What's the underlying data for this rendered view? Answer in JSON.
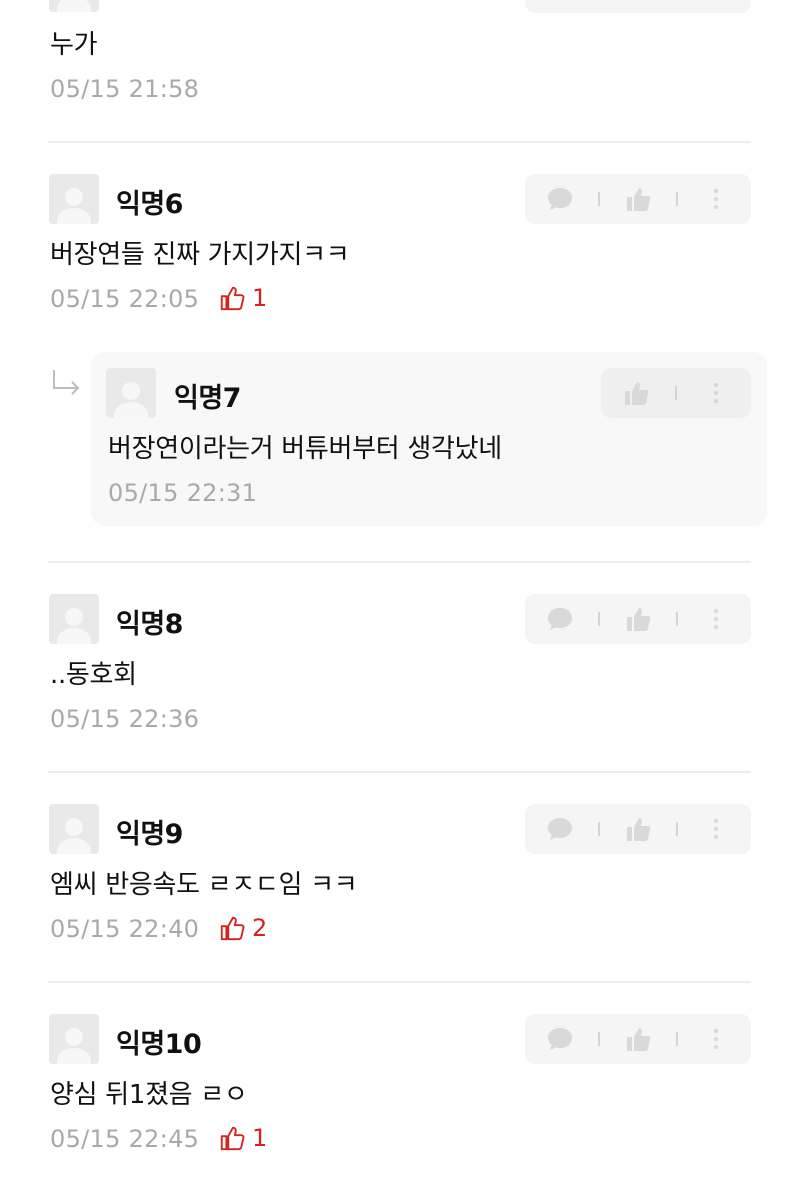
{
  "comments": [
    {
      "nick": "",
      "text": "누가",
      "time": "05/15 21:58",
      "likes": null
    },
    {
      "nick": "익명6",
      "text": "버장연들 진짜 가지가지ㅋㅋ",
      "time": "05/15 22:05",
      "likes": "1"
    },
    {
      "nick": "익명7",
      "text": "버장연이라는거 버튜버부터 생각났네",
      "time": "05/15 22:31",
      "likes": null,
      "is_reply": true
    },
    {
      "nick": "익명8",
      "text": "..동호회",
      "time": "05/15 22:36",
      "likes": null
    },
    {
      "nick": "익명9",
      "text": "엠씨 반응속도 ㄹㅈㄷ임 ㅋㅋ",
      "time": "05/15 22:40",
      "likes": "2"
    },
    {
      "nick": "익명10",
      "text": "양심 뒤1졌음 ㄹㅇ",
      "time": "05/15 22:45",
      "likes": "1"
    }
  ],
  "icons": {
    "comment": "speech-bubble-icon",
    "vote": "thumbs-up-icon",
    "more": "vertical-dots-icon",
    "like": "red-thumbs-up-icon",
    "reply": "reply-arrow-icon"
  },
  "colors": {
    "like": "#d6221d",
    "muted": "#a9a9a9",
    "panel": "#f5f5f5"
  }
}
